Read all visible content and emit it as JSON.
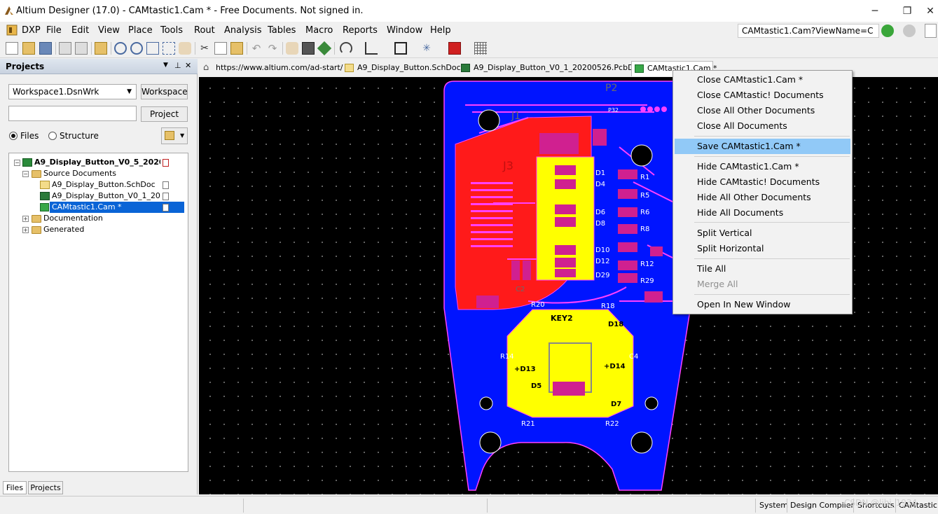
{
  "window": {
    "title": "Altium Designer (17.0) - CAMtastic1.Cam * - Free Documents. Not signed in.",
    "minimize": "─",
    "restore": "❐",
    "close": "✕"
  },
  "menubar": {
    "items": [
      "DXP",
      "File",
      "Edit",
      "View",
      "Place",
      "Tools",
      "Rout",
      "Analysis",
      "Tables",
      "Macro",
      "Reports",
      "Window",
      "Help"
    ],
    "url": "CAMtastic1.Cam?ViewName=C"
  },
  "panel": {
    "title": "Projects",
    "workspace_combo": "Workspace1.DsnWrk",
    "workspace_button": "Workspace",
    "search_value": "",
    "project_button": "Project",
    "radio_files": "Files",
    "radio_structure": "Structure",
    "tree": {
      "project": "A9_Display_Button_V0_5_2020052(",
      "source_docs": "Source Documents",
      "sch": "A9_Display_Button.SchDoc",
      "pcb": "A9_Display_Button_V0_1_2020",
      "cam": "CAMtastic1.Cam *",
      "documentation": "Documentation",
      "generated": "Generated"
    },
    "tabs": [
      "Files",
      "Projects"
    ]
  },
  "doctabs": [
    "https://www.altium.com/ad-start/",
    "A9_Display_Button.SchDoc",
    "A9_Display_Button_V0_1_20200526.PcbDoc",
    "CAMtastic1.Cam *"
  ],
  "pcb": {
    "labels": {
      "p2": "P2",
      "p32": "P32",
      "j1": "J1",
      "j3": "J3",
      "key2": "KEY2",
      "d1": "D1",
      "d4": "D4",
      "d6": "D6",
      "d8": "D8",
      "d10": "D10",
      "d12": "D12",
      "d29": "D29",
      "r1": "R1",
      "r5": "R5",
      "r6": "R6",
      "r8": "R8",
      "r12": "R12",
      "r29": "R29",
      "r14": "R14",
      "r18": "R18",
      "r20": "R20",
      "r21": "R21",
      "r22": "R22",
      "d13": "+D13",
      "d14": "+D14",
      "d18": "D18",
      "d7": "D7",
      "d5": "D5",
      "c4": "C4",
      "c2": "C2"
    }
  },
  "context_menu": {
    "groups": [
      [
        "Close CAMtastic1.Cam *",
        "Close CAMtastic! Documents",
        "Close All Other Documents",
        "Close All Documents"
      ],
      [
        "Save CAMtastic1.Cam *"
      ],
      [
        "Hide CAMtastic1.Cam *",
        "Hide CAMtastic! Documents",
        "Hide All Other Documents",
        "Hide All Documents"
      ],
      [
        "Split Vertical",
        "Split Horizontal"
      ],
      [
        "Tile All",
        "Merge All"
      ],
      [
        "Open In New Window"
      ]
    ],
    "highlighted": "Save CAMtastic1.Cam *",
    "disabled": "Merge All"
  },
  "statusbar": {
    "items": [
      "System",
      "Design Compiler",
      "Shortcuts",
      "CAMtastic"
    ],
    "watermark": "CSDN @lihi_1934"
  }
}
